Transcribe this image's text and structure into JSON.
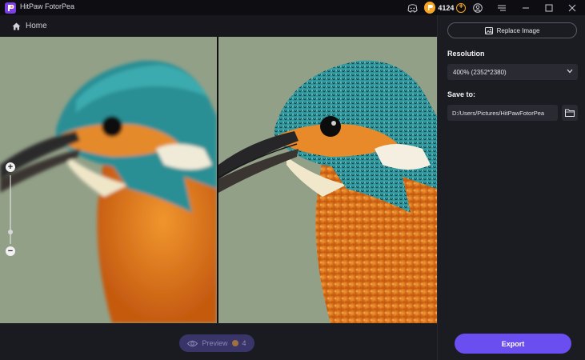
{
  "app": {
    "title": "HitPaw FotorPea",
    "credits": "4124"
  },
  "titlebar": {
    "icons": [
      "discord-icon",
      "coin-icon",
      "add-credits-icon",
      "account-icon",
      "menu-icon",
      "minimize-icon",
      "maximize-icon",
      "close-icon"
    ]
  },
  "nav": {
    "home_label": "Home"
  },
  "preview": {
    "label": "Preview",
    "cost": "4"
  },
  "panel": {
    "replace_label": "Replace Image",
    "resolution_label": "Resolution",
    "resolution_value": "400% (2352*2380)",
    "save_label": "Save to:",
    "save_path": "D:/Users/Pictures/HitPawFotorPea",
    "export_label": "Export"
  },
  "zoom": {
    "level": 0.18
  },
  "colors": {
    "accent": "#6b4ef0",
    "coin": "#f5a623",
    "background_sage": "#8e9a83",
    "bird_orange": "#e07b1c",
    "bird_teal": "#2f9aa0"
  }
}
